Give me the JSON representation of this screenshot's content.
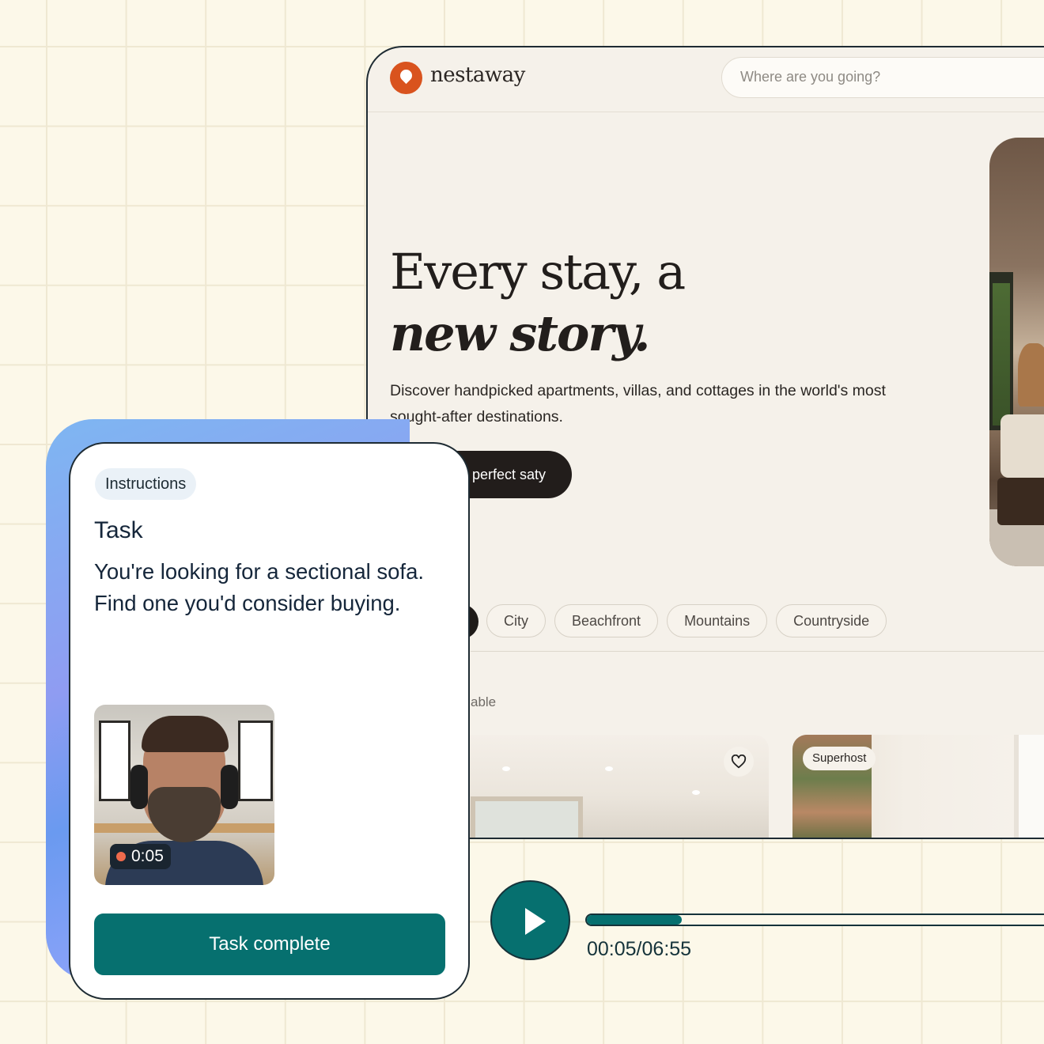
{
  "site": {
    "brand": "nestaway",
    "search_placeholder": "Where are you going?",
    "hero_line1": "Every stay, a",
    "hero_line2": "new story.",
    "hero_sub": "Discover handpicked apartments, villas, and cottages in the world's most sought-after destinations.",
    "cta_label": "perfect saty",
    "categories": [
      "City",
      "Beachfront",
      "Mountains",
      "Countryside"
    ],
    "section_label": "able",
    "card_badge": "Superhost",
    "colors": {
      "brand": "#d9531e",
      "background": "#f5f1ea",
      "ink": "#221e1c"
    }
  },
  "instructions": {
    "chip": "Instructions",
    "task_title": "Task",
    "task_text": "You're looking for a sectional sofa. Find one you'd consider buying.",
    "recording_time": "0:05",
    "complete_label": "Task complete",
    "accent": "#06706f"
  },
  "player": {
    "time": "00:05/06:55",
    "progress": 0.012,
    "play_icon": "play-icon"
  }
}
